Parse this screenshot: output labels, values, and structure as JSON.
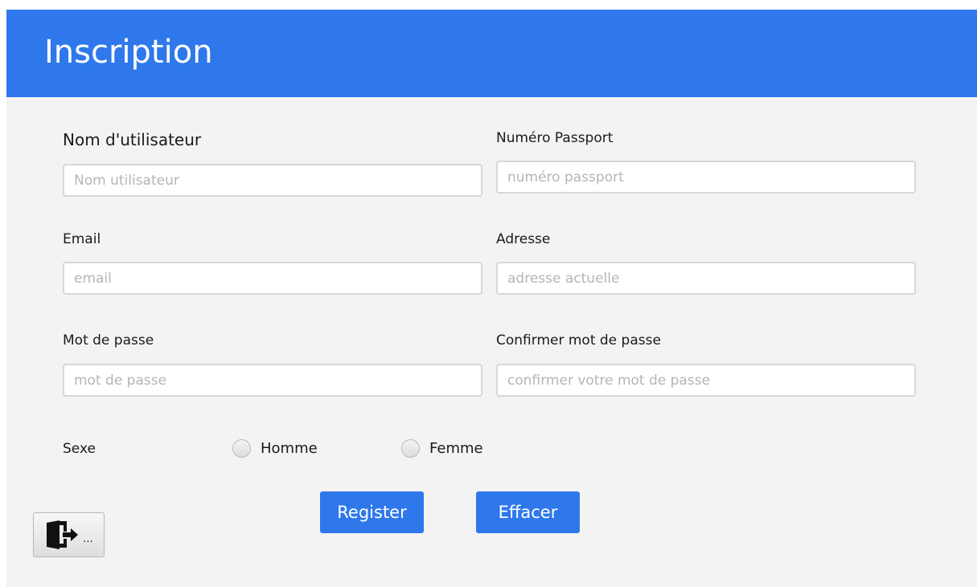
{
  "header": {
    "title": "Inscription",
    "color": "#2f78ec"
  },
  "form": {
    "username": {
      "label": "Nom d'utilisateur",
      "placeholder": "Nom utilisateur",
      "value": ""
    },
    "passport": {
      "label": "Numéro Passport",
      "placeholder": "numéro passport",
      "value": ""
    },
    "email": {
      "label": "Email",
      "placeholder": "email",
      "value": ""
    },
    "address": {
      "label": "Adresse",
      "placeholder": "adresse actuelle",
      "value": ""
    },
    "password": {
      "label": "Mot de passe",
      "placeholder": "mot de passe",
      "value": ""
    },
    "confirm_password": {
      "label": "Confirmer mot de passe",
      "placeholder": "confirmer votre mot de passe",
      "value": ""
    },
    "sex": {
      "label": "Sexe",
      "options": [
        "Homme",
        "Femme"
      ]
    }
  },
  "actions": {
    "register_label": "Register",
    "clear_label": "Effacer",
    "exit_label": "...",
    "exit_icon": "exit-door-icon"
  },
  "colors": {
    "accent": "#2f78ec",
    "background": "#f3f3f3"
  }
}
